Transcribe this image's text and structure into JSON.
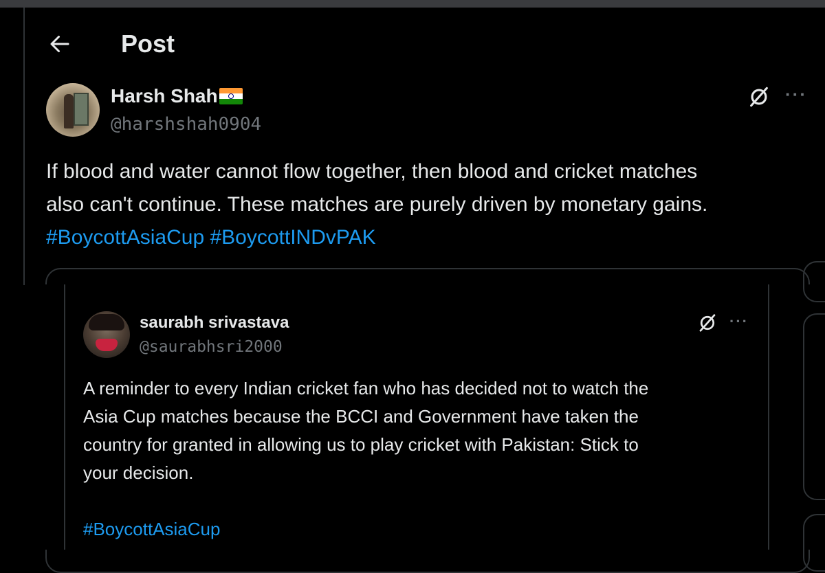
{
  "header": {
    "back_icon": "arrow-left-icon",
    "title": "Post"
  },
  "post": {
    "author": {
      "name": "Harsh Shah",
      "flag": "india-flag-icon",
      "handle": "@harshshah0904"
    },
    "text_lines": [
      "If blood and water cannot flow together, then blood and cricket matches",
      "also can't continue. These matches are purely driven by monetary gains."
    ],
    "hashtags": [
      "#BoycottAsiaCup",
      "#BoycottINDvPAK"
    ]
  },
  "quoted_post": {
    "author": {
      "name": "saurabh srivastava",
      "handle": "@saurabhsri2000"
    },
    "text_lines": [
      "A reminder to every Indian cricket fan who has decided not to watch the",
      "Asia Cup matches because the BCCI and Government have taken the",
      "country for granted in allowing us to play cricket with Pakistan: Stick to",
      "your decision."
    ],
    "hashtag": "#BoycottAsiaCup"
  },
  "icons": {
    "grok": "grok-icon",
    "more": "more-options-icon"
  },
  "colors": {
    "background": "#000000",
    "text": "#e7e9ea",
    "secondary": "#71767b",
    "link": "#1d9bf0",
    "border": "#2f3336"
  }
}
